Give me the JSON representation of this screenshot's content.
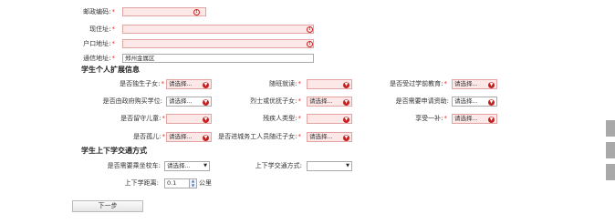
{
  "address": {
    "postcode_label": "邮政编码:",
    "current_label": "现住址:",
    "registered_label": "户口地址:",
    "mailing_label": "通信地址:",
    "mailing_value": "郑州金属区",
    "error_mark": "!"
  },
  "extended": {
    "title": "学生个人扩展信息",
    "row1": [
      {
        "label": "是否独生子女:",
        "value": "请选择..."
      },
      {
        "label": "随班就读:",
        "value": ""
      },
      {
        "label": "是否受过学前教育:",
        "value": "请选择..."
      }
    ],
    "row2": [
      {
        "label": "是否由政府购买学位:",
        "value": "请选择..."
      },
      {
        "label": "烈士或优抚子女:",
        "value": "请选择..."
      },
      {
        "label": "是否需要申请资助:",
        "value": "请选择..."
      }
    ],
    "row3": [
      {
        "label": "是否留守儿童:",
        "value": ""
      },
      {
        "label": "残疾人类型:",
        "value": ""
      },
      {
        "label": "享受一补:",
        "value": "请选择..."
      }
    ],
    "row4": [
      {
        "label": "是否孤儿:",
        "value": "请选择..."
      },
      {
        "label": "是否进城务工人员随迁子女:",
        "value": "请选择..."
      }
    ]
  },
  "transport": {
    "title": "学生上下学交通方式",
    "bus_label": "是否需要乘坐校车:",
    "bus_value": "请选择...",
    "mode_label": "上下学交通方式:",
    "mode_value": "",
    "distance_label": "上下学距离:",
    "distance_value": "0.1",
    "distance_unit": "公里"
  },
  "next_button": "下一步"
}
